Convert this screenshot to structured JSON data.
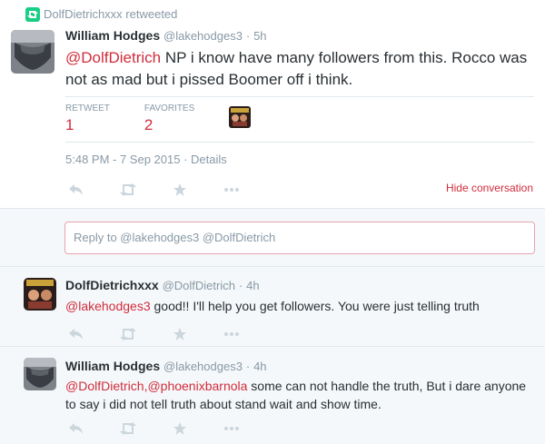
{
  "main_tweet": {
    "retweeted_by": "DolfDietrichxxx retweeted",
    "author_name": "William Hodges",
    "author_handle": "@lakehodges3",
    "time": "5h",
    "mention": "@DolfDietrich",
    "body": " NP i know have many followers  from this.   Rocco was not as mad but i pissed Boomer off i think.",
    "retweets_label": "RETWEET",
    "retweets_count": "1",
    "favorites_label": "FAVORITES",
    "favorites_count": "2",
    "timestamp": "5:48 PM - 7 Sep 2015 · Details",
    "hide_conversation": "Hide conversation"
  },
  "reply_box": {
    "placeholder": "Reply to @lakehodges3 @DolfDietrich"
  },
  "replies": [
    {
      "author_name": "DolfDietrichxxx",
      "author_handle": "@DolfDietrich",
      "time": "4h",
      "mention": "@lakehodges3",
      "body": " good!! I'll help you get followers. You were just telling truth"
    },
    {
      "author_name": "William Hodges",
      "author_handle": "@lakehodges3",
      "time": "4h",
      "mention": "@DolfDietrich,@phoenixbarnola",
      "body": " some can not handle the truth,  But i dare anyone to say i did not tell truth about stand wait and show time."
    }
  ],
  "dot": "·",
  "icons": [
    "retweet-badge-icon",
    "reply-icon",
    "retweet-icon",
    "favorite-icon",
    "more-icon"
  ],
  "colors": {
    "accent": "#d12c3c",
    "muted": "#8899a6",
    "rt_green": "#19cf86"
  }
}
